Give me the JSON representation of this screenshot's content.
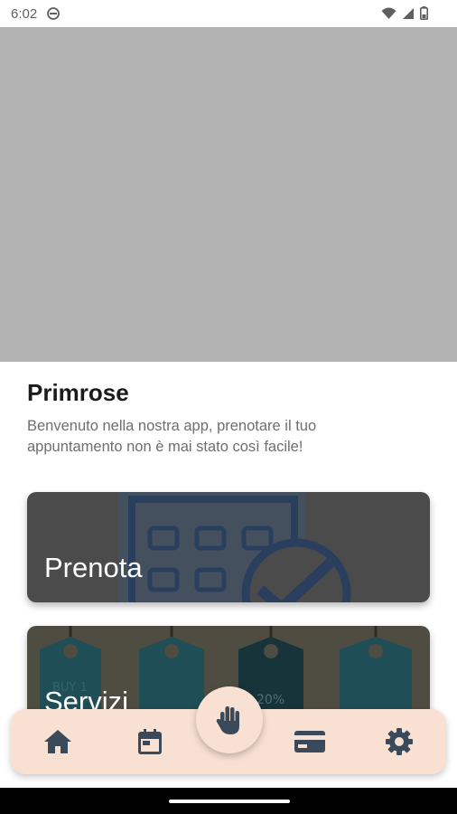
{
  "status_bar": {
    "time": "6:02"
  },
  "app": {
    "title": "Primrose",
    "subtitle": "Benvenuto nella nostra app, prenotare il tuo appuntamento non è mai stato così facile!"
  },
  "cards": [
    {
      "label": "Prenota"
    },
    {
      "label": "Servizi"
    }
  ],
  "tags": [
    "BUY 1",
    "20%"
  ],
  "colors": {
    "nav_background": "#f8e1d3",
    "nav_icon": "#3a4a5a",
    "hero_placeholder": "#b3b3b3"
  },
  "bottom_nav": {
    "items": [
      "home-icon",
      "calendar-icon",
      "hand-icon",
      "card-icon",
      "gear-icon"
    ]
  }
}
